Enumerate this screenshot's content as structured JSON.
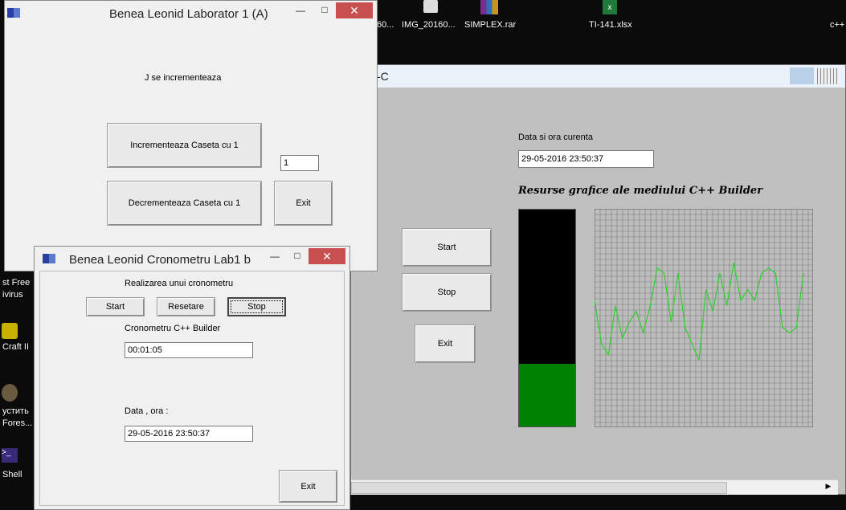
{
  "desktop": {
    "icons": [
      {
        "label": "60..."
      },
      {
        "label": "IMG_20160..."
      },
      {
        "label": "SIMPLEX.rar"
      },
      {
        "label": "TI-141.xlsx"
      },
      {
        "label": "c++"
      }
    ],
    "left_labels": [
      "st Free",
      "ivirus",
      "Craft II",
      "устить",
      "Fores...",
      "Shell"
    ]
  },
  "lab1": {
    "title": "Benea Leonid Laborator 1 (A)",
    "status_text": "J se incrementeaza",
    "increment_label": "Incrementeaza Caseta cu 1",
    "decrement_label": "Decrementeaza Caseta cu 1",
    "value": "1",
    "exit_label": "Exit"
  },
  "graphics": {
    "title_fragment": "-C",
    "datetime_caption": "Data si ora curenta",
    "datetime_value": "29-05-2016 23:50:37",
    "heading": "Resurse grafice ale mediului C++ Builder",
    "start_label": "Start",
    "stop_label": "Stop",
    "exit_label": "Exit",
    "gauge_level": 0.29,
    "gauge_color": "#008000",
    "wave_color": "#2fcf2f",
    "wave_values": [
      0.6,
      0.2,
      0.1,
      0.55,
      0.25,
      0.4,
      0.5,
      0.3,
      0.55,
      0.9,
      0.85,
      0.4,
      0.85,
      0.35,
      0.2,
      0.05,
      0.7,
      0.5,
      0.85,
      0.55,
      0.95,
      0.6,
      0.7,
      0.6,
      0.85,
      0.9,
      0.85,
      0.35,
      0.3,
      0.35,
      0.85
    ]
  },
  "cron": {
    "title": "Benea Leonid Cronometru  Lab1 b",
    "subtitle": "Realizarea unui cronometru",
    "start_label": "Start",
    "reset_label": "Resetare",
    "stop_label": "Stop",
    "timer_caption": "Cronometru C++ Builder",
    "timer_value": "00:01:05",
    "date_caption": "Data ,  ora  :",
    "date_value": "29-05-2016 23:50:37",
    "exit_label": "Exit"
  }
}
